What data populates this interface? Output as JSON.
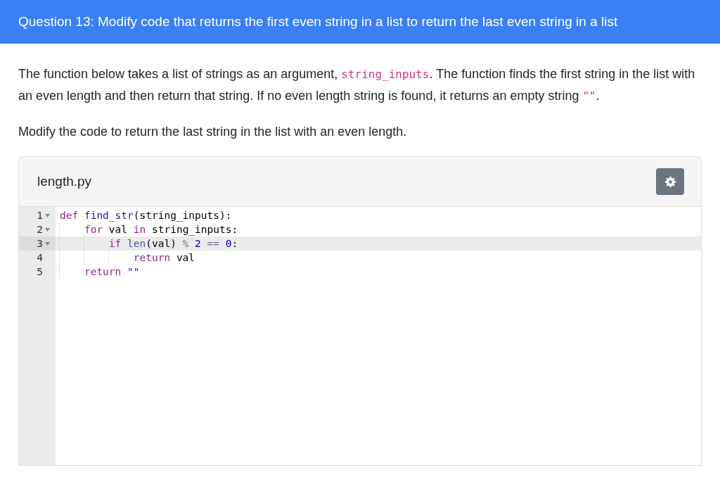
{
  "question_title": "Question 13: Modify code that returns the first even string in a list to return the last even string in a list",
  "paragraphs": [
    [
      {
        "kind": "text",
        "text": "The function below takes a list of strings as an argument, "
      },
      {
        "kind": "code",
        "text": "string_inputs"
      },
      {
        "kind": "text",
        "text": ". The function finds the first string in the list with an even length and then return that string. If no even length string is found, it returns an empty string "
      },
      {
        "kind": "code",
        "text": "\"\""
      },
      {
        "kind": "text",
        "text": "."
      }
    ],
    [
      {
        "kind": "text",
        "text": "Modify the code to return the last string in the list with an even length."
      }
    ]
  ],
  "editor": {
    "filename": "length.py",
    "lines": [
      {
        "number": "1",
        "foldable": true,
        "active": false,
        "tokens": [
          {
            "kind": "kw",
            "text": "def"
          },
          {
            "kind": "fn",
            "text": " find_str"
          },
          {
            "kind": "plain",
            "text": "(string_inputs):"
          }
        ]
      },
      {
        "number": "2",
        "foldable": true,
        "active": false,
        "tokens": [
          {
            "kind": "kw",
            "text": "    for"
          },
          {
            "kind": "plain",
            "text": " val"
          },
          {
            "kind": "kw",
            "text": " in"
          },
          {
            "kind": "plain",
            "text": " string_inputs:"
          }
        ]
      },
      {
        "number": "3",
        "foldable": true,
        "active": true,
        "tokens": [
          {
            "kind": "kw",
            "text": "        if"
          },
          {
            "kind": "builtin",
            "text": " len"
          },
          {
            "kind": "plain",
            "text": "(val)"
          },
          {
            "kind": "op",
            "text": " %"
          },
          {
            "kind": "num",
            "text": " 2"
          },
          {
            "kind": "op",
            "text": " =="
          },
          {
            "kind": "num",
            "text": " 0"
          },
          {
            "kind": "plain",
            "text": ":"
          }
        ]
      },
      {
        "number": "4",
        "foldable": false,
        "active": false,
        "tokens": [
          {
            "kind": "kw",
            "text": "            return"
          },
          {
            "kind": "plain",
            "text": " val"
          }
        ]
      },
      {
        "number": "5",
        "foldable": false,
        "active": false,
        "tokens": [
          {
            "kind": "kw",
            "text": "    return"
          },
          {
            "kind": "str",
            "text": " \"\""
          }
        ]
      }
    ]
  }
}
